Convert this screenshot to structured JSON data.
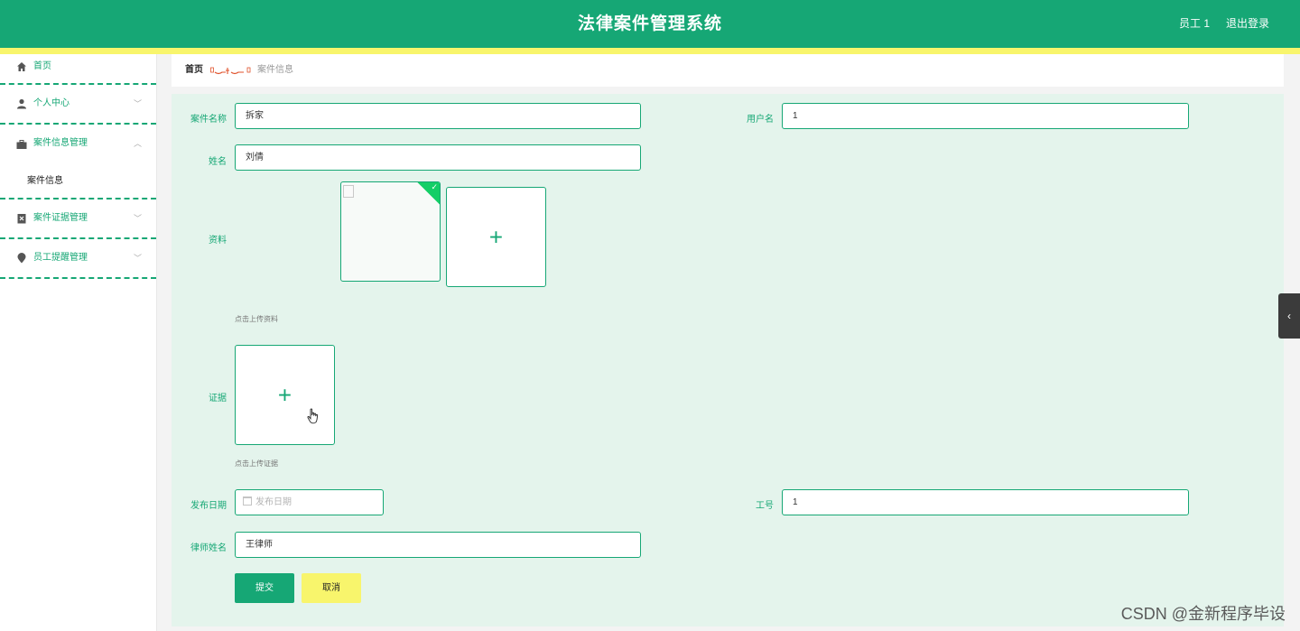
{
  "header": {
    "title": "法律案件管理系统",
    "user": "员工 1",
    "logout": "退出登录"
  },
  "sidebar": {
    "items": [
      {
        "label": "首页",
        "icon": "home-icon"
      },
      {
        "label": "个人中心",
        "icon": "user-icon",
        "arrow": "﹀"
      },
      {
        "label": "案件信息管理",
        "icon": "briefcase-icon",
        "arrow": "︿",
        "sub": "案件信息"
      },
      {
        "label": "案件证据管理",
        "icon": "evidence-icon",
        "arrow": "﹀"
      },
      {
        "label": "员工提醒管理",
        "icon": "location-pin-icon",
        "arrow": "﹀"
      }
    ]
  },
  "breadcrumb": {
    "home": "首页",
    "current": "案件信息"
  },
  "form": {
    "case_name_label": "案件名称",
    "case_name_value": "拆家",
    "username_label": "用户名",
    "username_value": "1",
    "name_label": "姓名",
    "name_value": "刘倩",
    "material_label": "资料",
    "material_tip": "点击上传资料",
    "evidence_label": "证据",
    "evidence_tip": "点击上传证据",
    "date_label": "发布日期",
    "date_placeholder": "发布日期",
    "job_no_label": "工号",
    "job_no_value": "1",
    "lawyer_label": "律师姓名",
    "lawyer_value": "王律师",
    "submit": "提交",
    "cancel": "取消",
    "plus": "+"
  },
  "watermark": "CSDN @金新程序毕设",
  "colors": {
    "primary": "#16a775",
    "accent": "#f8f56c",
    "form_bg": "#e4f4ec"
  }
}
